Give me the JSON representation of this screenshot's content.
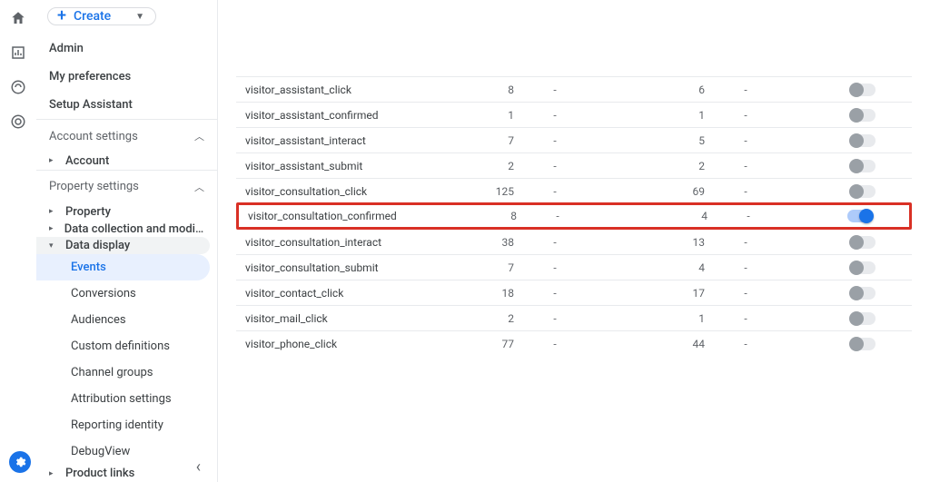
{
  "create_label": "Create",
  "nav_top": [
    {
      "label": "Admin"
    },
    {
      "label": "My preferences"
    },
    {
      "label": "Setup Assistant"
    }
  ],
  "account_section": {
    "label": "Account settings",
    "items": [
      {
        "label": "Account"
      }
    ]
  },
  "property_section": {
    "label": "Property settings",
    "items": [
      {
        "label": "Property",
        "children": null
      },
      {
        "label": "Data collection and modifica...",
        "children": null
      },
      {
        "label": "Data display",
        "expanded": true,
        "children": [
          "Events",
          "Conversions",
          "Audiences",
          "Custom definitions",
          "Channel groups",
          "Attribution settings",
          "Reporting identity",
          "DebugView"
        ]
      },
      {
        "label": "Product links",
        "children": null
      }
    ]
  },
  "active_sub": "Events",
  "events": [
    {
      "name": "visitor_assistant_click",
      "c1": "8",
      "c2": "6",
      "on": false,
      "hl": false
    },
    {
      "name": "visitor_assistant_confirmed",
      "c1": "1",
      "c2": "1",
      "on": false,
      "hl": false
    },
    {
      "name": "visitor_assistant_interact",
      "c1": "7",
      "c2": "5",
      "on": false,
      "hl": false
    },
    {
      "name": "visitor_assistant_submit",
      "c1": "2",
      "c2": "2",
      "on": false,
      "hl": false
    },
    {
      "name": "visitor_consultation_click",
      "c1": "125",
      "c2": "69",
      "on": false,
      "hl": false
    },
    {
      "name": "visitor_consultation_confirmed",
      "c1": "8",
      "c2": "4",
      "on": true,
      "hl": true
    },
    {
      "name": "visitor_consultation_interact",
      "c1": "38",
      "c2": "13",
      "on": false,
      "hl": false
    },
    {
      "name": "visitor_consultation_submit",
      "c1": "7",
      "c2": "4",
      "on": false,
      "hl": false
    },
    {
      "name": "visitor_contact_click",
      "c1": "18",
      "c2": "17",
      "on": false,
      "hl": false
    },
    {
      "name": "visitor_mail_click",
      "c1": "2",
      "c2": "1",
      "on": false,
      "hl": false
    },
    {
      "name": "visitor_phone_click",
      "c1": "77",
      "c2": "44",
      "on": false,
      "hl": false
    }
  ],
  "dash": "-"
}
